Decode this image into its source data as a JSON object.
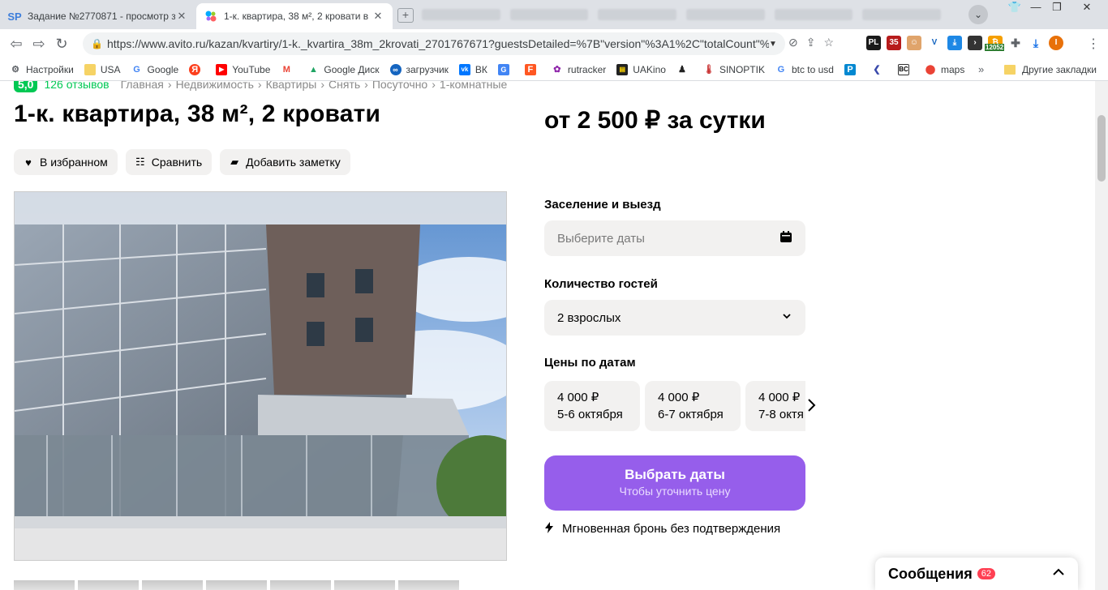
{
  "browser": {
    "tabs": [
      {
        "favicon": "SP",
        "title": "Задание №2770871 - просмотр з",
        "active": false
      },
      {
        "favicon": "avito-dots",
        "title": "1-к. квартира, 38 м², 2 кровати в",
        "active": true
      }
    ],
    "url": "https://www.avito.ru/kazan/kvartiry/1-k._kvartira_38m_2krovati_2701767671?guestsDetailed=%7B\"version\"%3A1%2C\"totalCount\"%...",
    "bookmarks": [
      {
        "icon": "gear-icon",
        "label": "Настройки"
      },
      {
        "icon": "folder-icon",
        "label": "USA"
      },
      {
        "icon": "google-icon",
        "label": "Google"
      },
      {
        "icon": "yandex-icon",
        "label": ""
      },
      {
        "icon": "youtube-icon",
        "label": "YouTube"
      },
      {
        "icon": "gmail-icon",
        "label": ""
      },
      {
        "icon": "drive-icon",
        "label": "Google Диск"
      },
      {
        "icon": "infinity-icon",
        "label": "загрузчик"
      },
      {
        "icon": "vk-icon",
        "label": "ВК"
      },
      {
        "icon": "translate-icon",
        "label": ""
      },
      {
        "icon": "f-icon",
        "label": ""
      },
      {
        "icon": "flower-icon",
        "label": "rutracker"
      },
      {
        "icon": "film-icon",
        "label": "UAKino"
      },
      {
        "icon": "silhouette-icon",
        "label": ""
      },
      {
        "icon": "thermometer-icon",
        "label": "SINOPTIK"
      },
      {
        "icon": "google-icon",
        "label": "btc to usd"
      },
      {
        "icon": "p-icon",
        "label": ""
      },
      {
        "icon": "arrow-icon",
        "label": ""
      },
      {
        "icon": "bc-icon",
        "label": ""
      },
      {
        "icon": "map-pin-icon",
        "label": "maps"
      }
    ],
    "other_bookmarks": "Другие закладки",
    "ext_badge": "12052"
  },
  "listing": {
    "rating": "5,0",
    "reviews": "126 отзывов",
    "breadcrumbs": [
      "Главная",
      "Недвижимость",
      "Квартиры",
      "Снять",
      "Посуточно",
      "1-комнатные"
    ],
    "title": "1-к. квартира, 38 м², 2 кровати",
    "price": "от 2 500 ₽ за сутки",
    "actions": {
      "favorite": "В избранном",
      "compare": "Сравнить",
      "note": "Добавить заметку"
    }
  },
  "booking": {
    "checkin_label": "Заселение и выезд",
    "checkin_placeholder": "Выберите даты",
    "guests_label": "Количество гостей",
    "guests_value": "2 взрослых",
    "prices_label": "Цены по датам",
    "price_cards": [
      {
        "price": "4 000 ₽",
        "dates": "5-6 октября"
      },
      {
        "price": "4 000 ₽",
        "dates": "6-7 октября"
      },
      {
        "price": "4 000 ₽",
        "dates": "7-8 октя"
      }
    ],
    "cta_title": "Выбрать даты",
    "cta_subtitle": "Чтобы уточнить цену",
    "instant": "Мгновенная бронь без подтверждения"
  },
  "messages": {
    "label": "Сообщения",
    "count": "62"
  }
}
